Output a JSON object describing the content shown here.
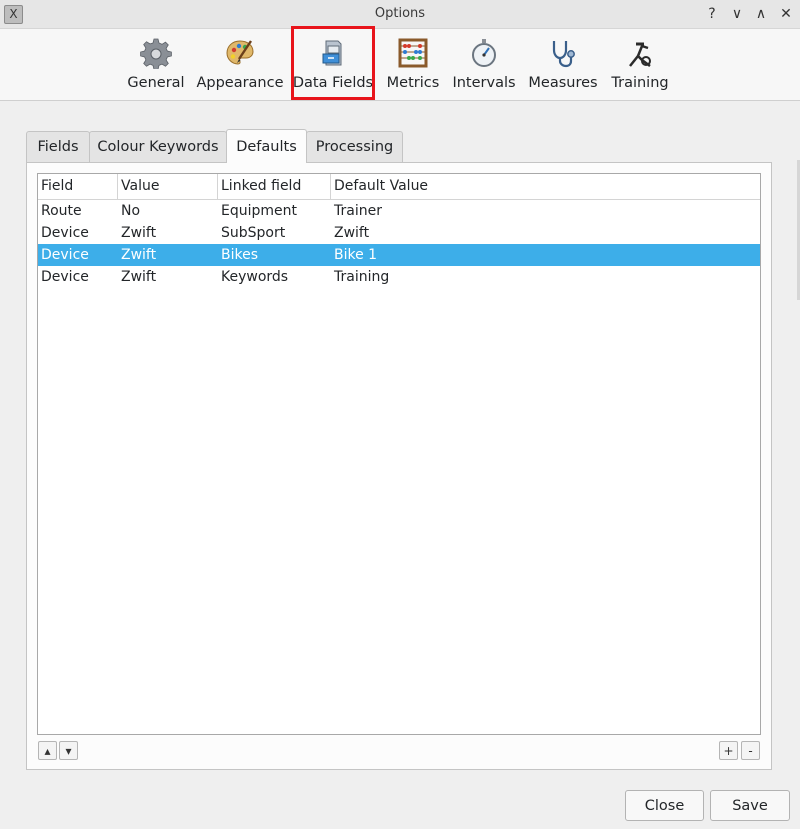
{
  "window": {
    "title": "Options",
    "app_icon_glyph": "X",
    "help_glyph": "?",
    "minimize_glyph": "∨",
    "maximize_glyph": "∧",
    "close_glyph": "✕"
  },
  "toolbar": {
    "items": [
      {
        "label": "General",
        "icon": "gear-icon"
      },
      {
        "label": "Appearance",
        "icon": "palette-icon"
      },
      {
        "label": "Data Fields",
        "icon": "file-cabinet-icon"
      },
      {
        "label": "Metrics",
        "icon": "abacus-icon"
      },
      {
        "label": "Intervals",
        "icon": "stopwatch-icon"
      },
      {
        "label": "Measures",
        "icon": "stethoscope-icon"
      },
      {
        "label": "Training",
        "icon": "bike-trainer-icon"
      }
    ],
    "highlight_color": "#e8141b"
  },
  "tabs": [
    {
      "label": "Fields"
    },
    {
      "label": "Colour Keywords"
    },
    {
      "label": "Defaults",
      "active": true
    },
    {
      "label": "Processing"
    }
  ],
  "table": {
    "columns": [
      "Field",
      "Value",
      "Linked field",
      "Default Value"
    ],
    "rows": [
      {
        "field": "Route",
        "value": "No",
        "linked": "Equipment",
        "default": "Trainer"
      },
      {
        "field": "Device",
        "value": "Zwift",
        "linked": "SubSport",
        "default": "Zwift"
      },
      {
        "field": "Device",
        "value": "Zwift",
        "linked": "Bikes",
        "default": "Bike 1",
        "selected": true
      },
      {
        "field": "Device",
        "value": "Zwift",
        "linked": "Keywords",
        "default": "Training"
      }
    ],
    "selection_color": "#3daee9"
  },
  "list_controls": {
    "up_glyph": "▴",
    "down_glyph": "▾",
    "add_glyph": "+",
    "remove_glyph": "-"
  },
  "buttons": {
    "close": "Close",
    "save": "Save"
  }
}
